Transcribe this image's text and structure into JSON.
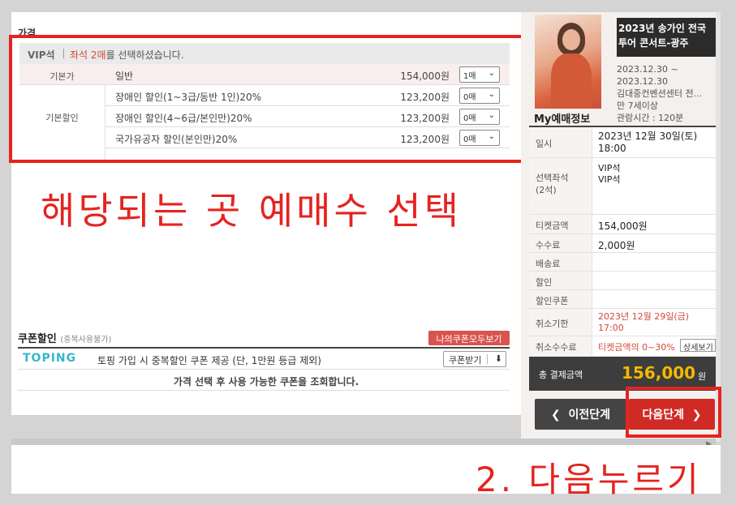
{
  "price": {
    "section_title": "가격",
    "vip_label": "VIP석",
    "vip_msg_prefix": "좌석 2매",
    "vip_msg_suffix": "를 선택하셨습니다.",
    "rows": [
      {
        "category": "기본가",
        "name": "일반",
        "price": "154,000원",
        "qty": "1매"
      },
      {
        "category": "기본할인",
        "name": "장애인 할인(1~3급/동반 1인)20%",
        "price": "123,200원",
        "qty": "0매"
      },
      {
        "category": "",
        "name": "장애인 할인(4~6급/본인만)20%",
        "price": "123,200원",
        "qty": "0매"
      },
      {
        "category": "",
        "name": "국가유공자 할인(본인만)20%",
        "price": "123,200원",
        "qty": "0매"
      }
    ]
  },
  "annotation_1": "해당되는 곳 예매수 선택",
  "annotation_2": "2. 다음누르기",
  "coupon": {
    "title": "쿠폰할인",
    "sub": "(중복사용불가)",
    "all_button": "나의쿠폰모두보기",
    "brand": "TOPING",
    "desc": "토핑 가입 시 중복할인 쿠폰 제공 (단, 1만원 등급 제외)",
    "get_button": "쿠폰받기",
    "note": "가격 선택 후 사용 가능한 쿠폰을 조회합니다."
  },
  "event": {
    "title": "2023년 송가인 전국 투어 콘서트-광주",
    "dates": "2023.12.30 ~\n2023.12.30",
    "venue": "김대중컨벤션센터 전...",
    "age": "만 7세이상",
    "runtime": "관람시간 : 120분"
  },
  "my": {
    "title": "My예매정보",
    "date_label": "일시",
    "date_value": "2023년 12월 30일(토)\n18:00",
    "seat_label": "선택좌석\n(2석)",
    "seat_value": "VIP석\nVIP석",
    "ticket_label": "티켓금액",
    "ticket_value": "154,000원",
    "fee_label": "수수료",
    "fee_value": "2,000원",
    "delivery_label": "배송료",
    "discount_label": "할인",
    "coupon_label": "할인쿠폰",
    "cancel_deadline_label": "취소기한",
    "cancel_deadline_value": "2023년 12월 29일(금)\n17:00",
    "cancel_fee_label": "취소수수료",
    "cancel_fee_value": "티켓금액의 0~30%",
    "detail_button": "상세보기",
    "total_label": "총 결제금액",
    "total_value": "156,000",
    "total_unit": "원"
  },
  "nav": {
    "prev": "이전단계",
    "next": "다음단계"
  },
  "colors": {
    "accent_red": "#e5231f",
    "total_yellow": "#f5b800"
  }
}
